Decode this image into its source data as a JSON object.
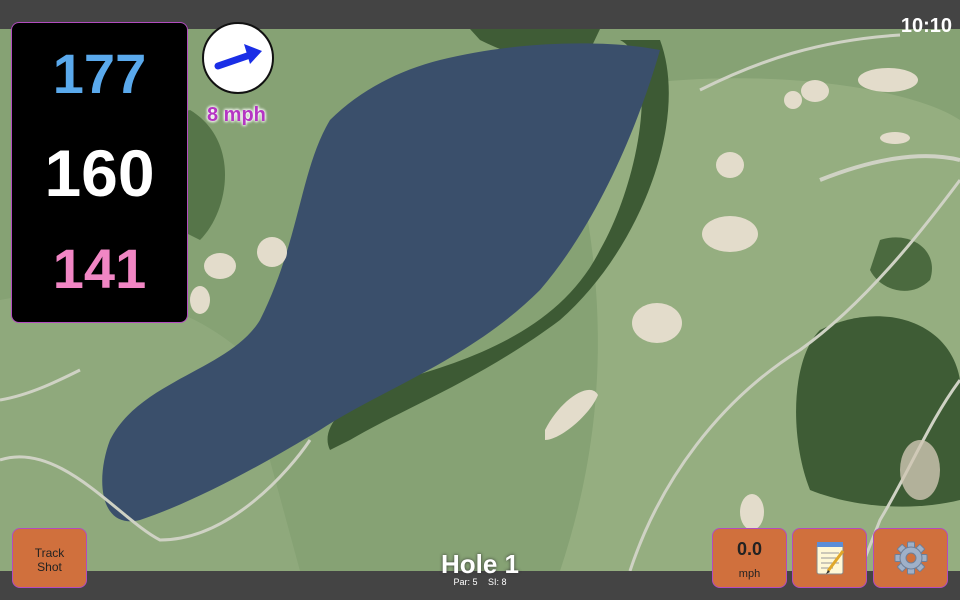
{
  "status": {
    "time": "10:10"
  },
  "distances": {
    "back": "177",
    "center": "160",
    "front": "141"
  },
  "wind": {
    "speed": "8 mph",
    "arrow_icon": "wind-arrow-icon"
  },
  "hole": {
    "title": "Hole 1",
    "par": "Par: 5",
    "si": "SI: 8"
  },
  "buttons": {
    "track_line1": "Track",
    "track_line2": "Shot",
    "speed_value": "0.0",
    "speed_unit": "mph",
    "notes_icon": "notepad-icon",
    "settings_icon": "gear-icon"
  },
  "colors": {
    "back": "#5aa9ec",
    "center": "#ffffff",
    "front": "#f186c4",
    "wind_text": "#b535c3",
    "button": "#d0703d",
    "border": "#b24cbf"
  }
}
